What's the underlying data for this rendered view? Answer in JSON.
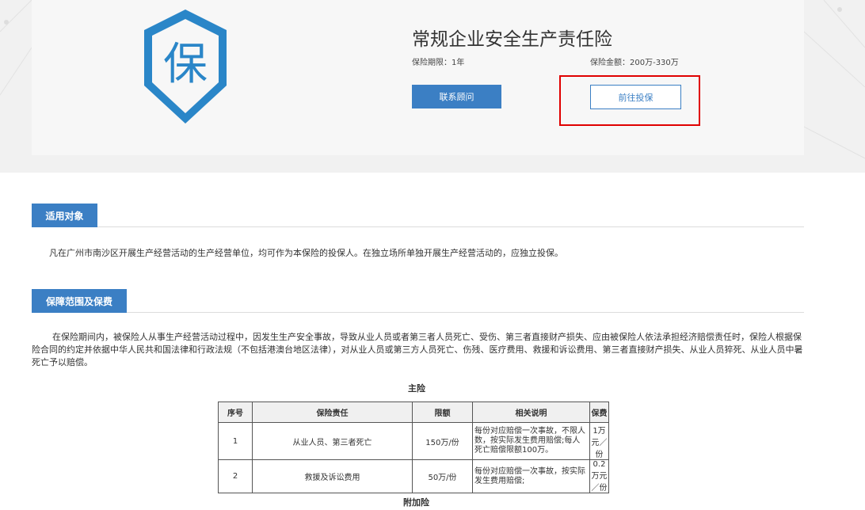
{
  "product": {
    "shield_char": "保",
    "title": "常规企业安全生产责任险",
    "term": "保险期限：1年",
    "amount": "保险金额：200万-330万",
    "contact_label": "联系顾问",
    "apply_label": "前往投保"
  },
  "sections": {
    "applicable": {
      "title": "适用对象",
      "text": "凡在广州市南沙区开展生产经营活动的生产经营单位，均可作为本保险的投保人。在独立场所单独开展生产经营活动的，应独立投保。"
    },
    "coverage": {
      "title": "保障范围及保费",
      "text": "在保险期间内，被保险人从事生产经营活动过程中，因发生生产安全事故，导致从业人员或者第三者人员死亡、受伤、第三者直接财产损失、应由被保险人依法承担经济赔偿责任时，保险人根据保险合同的约定并依据中华人民共和国法律和行政法规（不包括港澳台地区法律），对从业人员或第三方人员死亡、伤残、医疗费用、救援和诉讼费用、第三者直接财产损失、从业人员猝死、从业人员中暑死亡予以赔偿。"
    }
  },
  "main_table": {
    "caption": "主险",
    "headers": [
      "序号",
      "保险责任",
      "限额",
      "相关说明",
      "保费"
    ],
    "rows": [
      [
        "1",
        "从业人员、第三者死亡",
        "150万/份",
        "每份对应赔偿一次事故，不限人数，按实际发生费用赔偿;每人死亡赔偿限额100万。",
        "1万元／份"
      ],
      [
        "2",
        "救援及诉讼费用",
        "50万/份",
        "每份对应赔偿一次事故，按实际发生费用赔偿;",
        "0.2万元／份"
      ]
    ]
  },
  "addon": {
    "caption": "附加险"
  },
  "colors": {
    "primary": "#3b7fc4",
    "highlight": "#e00000",
    "shield": "#2a86c8"
  }
}
